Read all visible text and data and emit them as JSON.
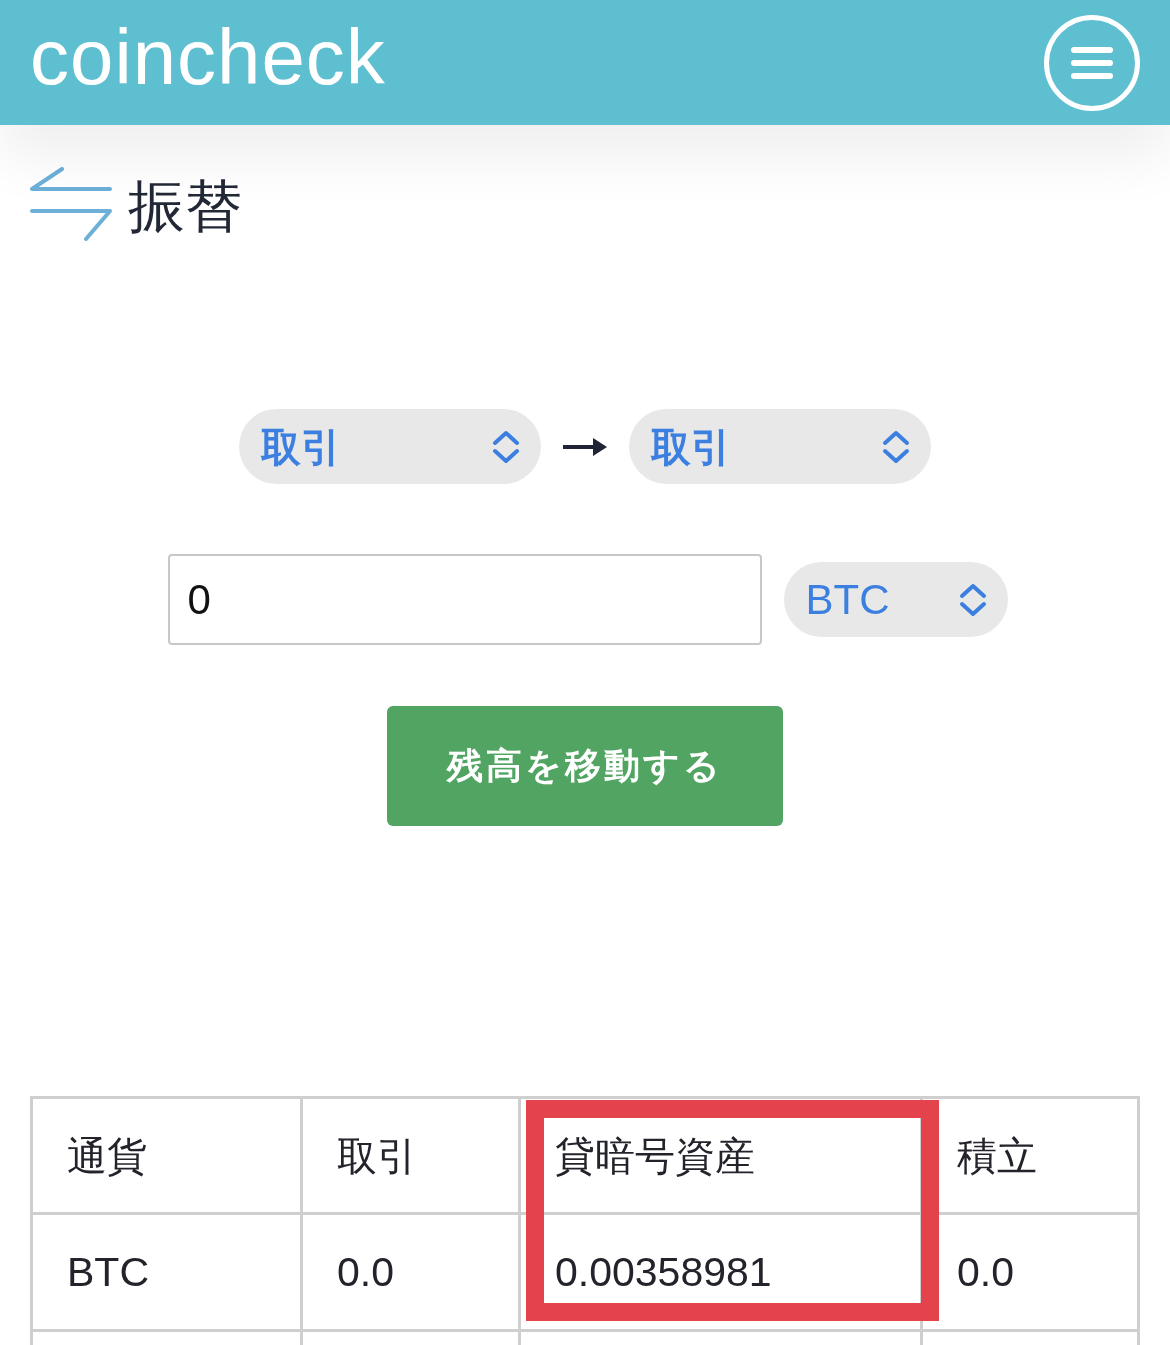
{
  "header": {
    "logo": "coincheck"
  },
  "page_title": "振替",
  "transfer": {
    "from": {
      "value": "取引"
    },
    "to": {
      "value": "取引"
    },
    "amount": {
      "value": "0"
    },
    "currency": {
      "value": "BTC"
    },
    "submit": "残高を移動する"
  },
  "balance_table": {
    "columns": [
      {
        "label": "通貨",
        "highlighted": false
      },
      {
        "label": "取引",
        "highlighted": false
      },
      {
        "label": "貸暗号資産",
        "highlighted": true
      },
      {
        "label": "積立",
        "highlighted": false
      }
    ],
    "rows": [
      [
        "BTC",
        "0.0",
        "0.00358981",
        "0.0"
      ]
    ]
  }
}
